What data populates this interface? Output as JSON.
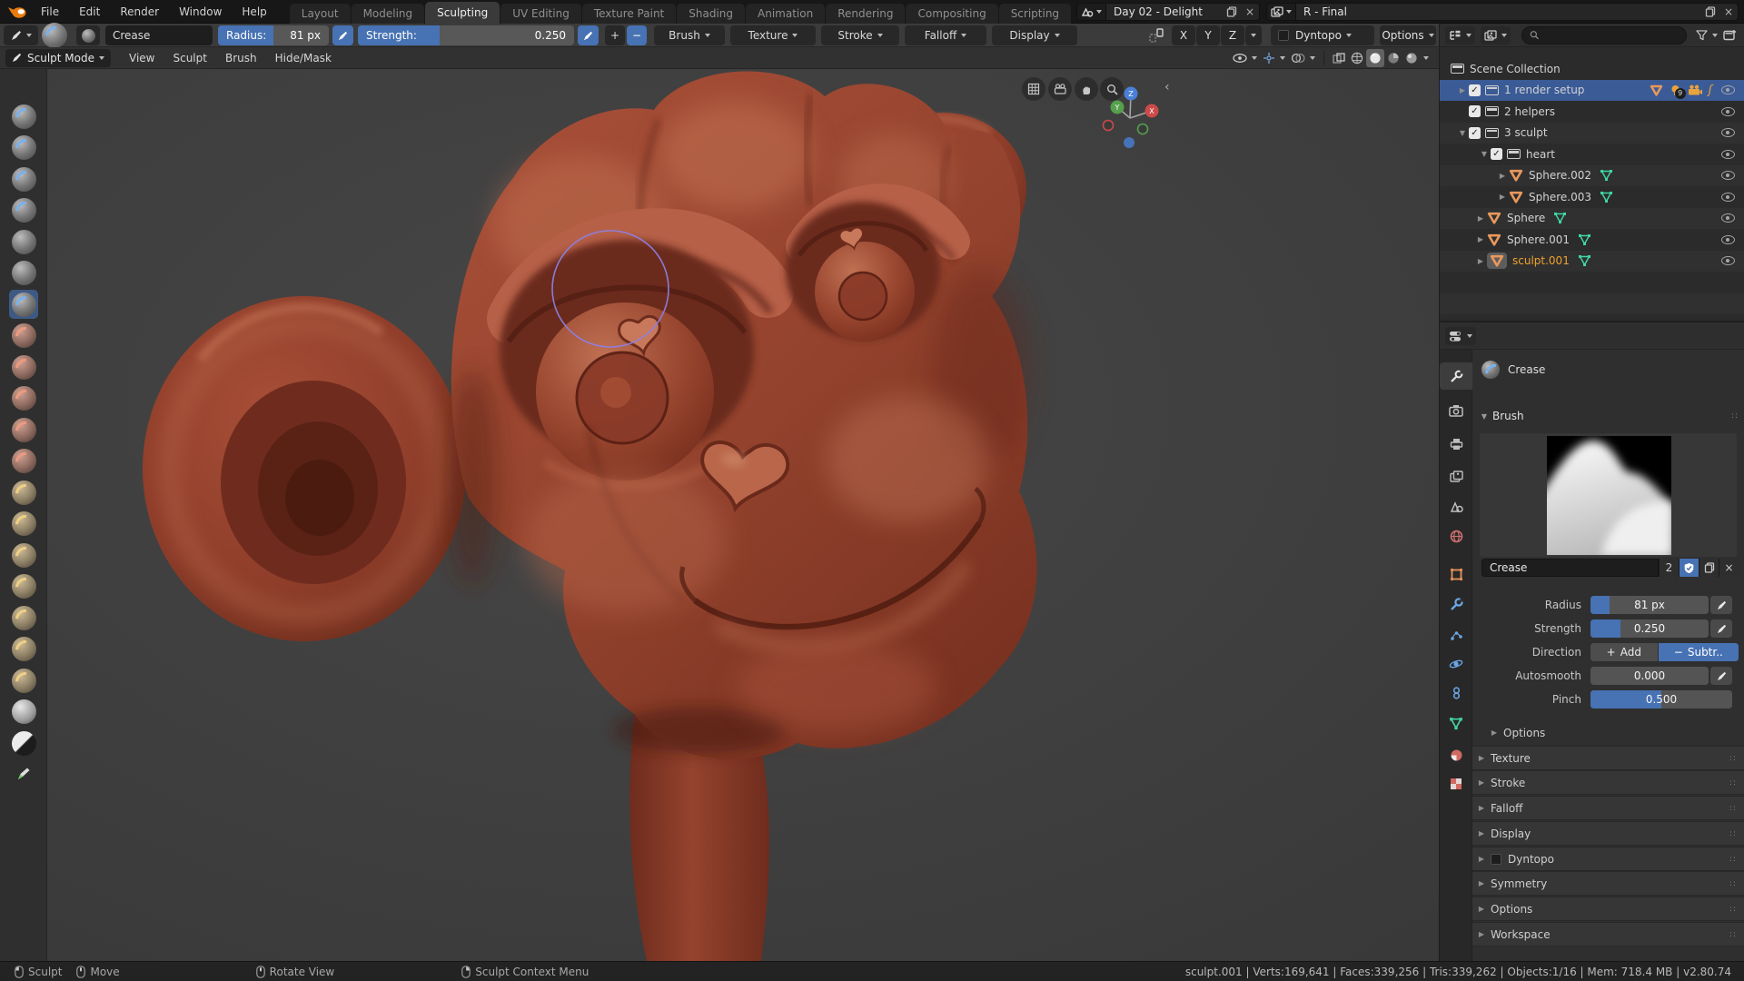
{
  "topbar": {
    "menus": [
      "File",
      "Edit",
      "Render",
      "Window",
      "Help"
    ],
    "tabs": [
      "Layout",
      "Modeling",
      "Sculpting",
      "UV Editing",
      "Texture Paint",
      "Shading",
      "Animation",
      "Rendering",
      "Compositing",
      "Scripting"
    ],
    "new_tab": "+",
    "scene": {
      "value": "Day 02 - Delight"
    },
    "view_layer": {
      "value": "R - Final"
    }
  },
  "tool_settings": {
    "brush_name": "Crease",
    "radius": {
      "label": "Radius:",
      "value": "81 px",
      "fill": 50
    },
    "strength": {
      "label": "Strength:",
      "value": "0.250",
      "fill": 38
    },
    "popovers": [
      "Brush",
      "Texture",
      "Stroke",
      "Falloff",
      "Display"
    ],
    "mirror": {
      "x": "X",
      "y": "Y",
      "z": "Z"
    },
    "dyntopo_label": "Dyntopo",
    "options_label": "Options"
  },
  "viewport": {
    "mode": "Sculpt Mode",
    "menus": [
      "View",
      "Sculpt",
      "Brush",
      "Hide/Mask"
    ],
    "gizmo": {
      "x": "X",
      "y": "Y",
      "z": "Z"
    }
  },
  "toolbar": {
    "active_tool": "Crease",
    "tools": [
      "Draw",
      "Clay",
      "Clay Strips",
      "Layer",
      "Inflate",
      "Blob",
      "Crease",
      "Smooth",
      "Flatten",
      "Fill",
      "Scrape",
      "Pinch",
      "Grab",
      "Elastic Deform",
      "Snake Hook",
      "Thumb",
      "Pose",
      "Nudge",
      "Rotate",
      "Simplify",
      "Mask",
      "Annotate"
    ]
  },
  "outliner": {
    "rows": [
      {
        "label": "Scene Collection"
      },
      {
        "label": "1 render setup",
        "badge": "9"
      },
      {
        "label": "2 helpers"
      },
      {
        "label": "3 sculpt"
      },
      {
        "label": "heart"
      },
      {
        "label": "Sphere.002"
      },
      {
        "label": "Sphere.003"
      },
      {
        "label": "Sphere"
      },
      {
        "label": "Sphere.001"
      },
      {
        "label": "sculpt.001"
      }
    ]
  },
  "properties": {
    "breadcrumb": "Crease",
    "brush_panel_label": "Brush",
    "name_field": {
      "value": "Crease",
      "users": "2"
    },
    "radius": {
      "label": "Radius",
      "value": "81 px",
      "fill": 16
    },
    "strength": {
      "label": "Strength",
      "value": "0.250",
      "fill": 25
    },
    "direction": {
      "label": "Direction",
      "add": "Add",
      "subtract": "Subtr.."
    },
    "autosmooth": {
      "label": "Autosmooth",
      "value": "0.000",
      "fill": 0
    },
    "pinch": {
      "label": "Pinch",
      "value": "0.500",
      "fill": 50
    },
    "subpanels": [
      {
        "label": "Options"
      },
      {
        "label": "Texture"
      },
      {
        "label": "Stroke"
      },
      {
        "label": "Falloff"
      },
      {
        "label": "Display"
      },
      {
        "label": "Dyntopo"
      },
      {
        "label": "Symmetry"
      },
      {
        "label": "Options"
      },
      {
        "label": "Workspace"
      }
    ]
  },
  "statusbar": {
    "left": [
      "Sculpt",
      "Move",
      "Rotate View",
      "Sculpt Context Menu"
    ],
    "right": "sculpt.001 | Verts:169,641 | Faces:339,256 | Tris:339,262 | Objects:1/16 | Mem: 718.4 MB | v2.80.74"
  },
  "glyphs": {
    "expand": "▶",
    "collapse": "▼",
    "check": "✓",
    "close": "×",
    "plus": "+",
    "minus": "−",
    "fcurve": "ʃ",
    "back": "‹"
  }
}
